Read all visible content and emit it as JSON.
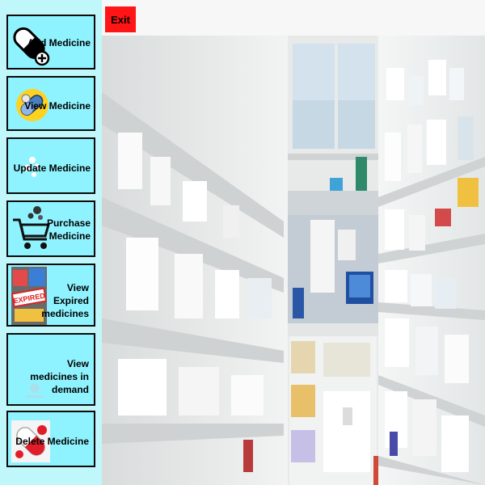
{
  "topbar": {
    "exit_label": "Exit"
  },
  "sidebar": {
    "items": [
      {
        "label": "Add Medicine",
        "icon": "pill-add-icon"
      },
      {
        "label": "View Medicine",
        "icon": "pills-view-icon"
      },
      {
        "label": "Update Medicine",
        "icon": "sparkle-update-icon"
      },
      {
        "label": "Purchase Medicine",
        "icon": "shopping-cart-icon"
      },
      {
        "label": "View Expired medicines",
        "icon": "expired-stamp-icon"
      },
      {
        "label": "View medicines in demand",
        "icon": "demand-icon"
      },
      {
        "label": "Delete Medicine",
        "icon": "delete-pill-icon"
      }
    ]
  },
  "colors": {
    "sidebar_bg": "#bff7fb",
    "button_bg": "#8ff3ff",
    "exit_bg": "#ff1515",
    "border": "#0a0a0a"
  }
}
